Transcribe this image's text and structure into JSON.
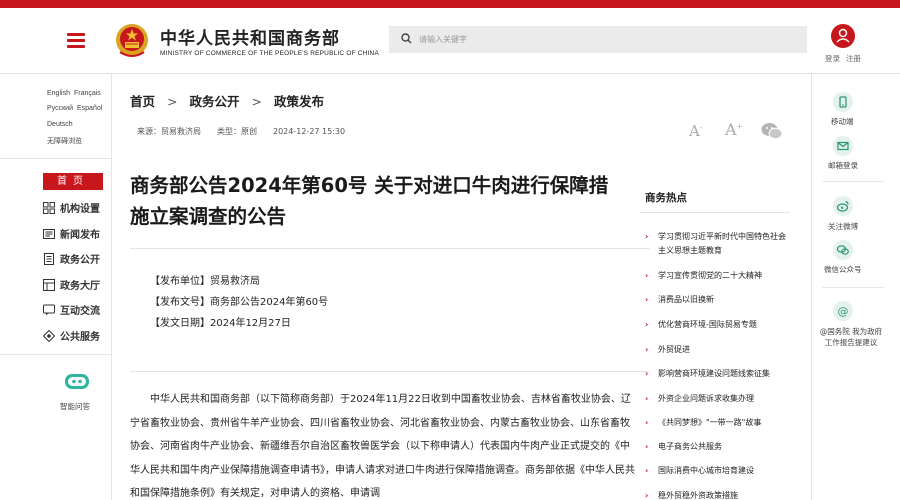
{
  "header": {
    "logo_cn": "中华人民共和国商务部",
    "logo_en": "MINISTRY OF COMMERCE OF THE PEOPLE'S REPUBLIC OF CHINA",
    "search_placeholder": "请输入关键字",
    "login": "登录",
    "register": "注册"
  },
  "left": {
    "languages": [
      [
        "English",
        "Français"
      ],
      [
        "Русский",
        "Español"
      ],
      [
        "Deutsch"
      ]
    ],
    "accessibility": "无障碍浏览",
    "nav_home": "首页",
    "nav": [
      "机构设置",
      "新闻发布",
      "政务公开",
      "政务大厅",
      "互动交流",
      "公共服务"
    ],
    "robot_label": "智能问答"
  },
  "breadcrumb": [
    "首页",
    "政务公开",
    "政策发布"
  ],
  "meta": {
    "source": "来源：贸易救济局",
    "type": "类型：原创",
    "date": "2024-12-27 15:30"
  },
  "article": {
    "title": "商务部公告2024年第60号 关于对进口牛肉进行保障措施立案调查的公告",
    "info": [
      "【发布单位】贸易救济局",
      "【发布文号】商务部公告2024年第60号",
      "【发文日期】2024年12月27日"
    ],
    "body": "中华人民共和国商务部（以下简称商务部）于2024年11月22日收到中国畜牧业协会、吉林省畜牧业协会、辽宁省畜牧业协会、贵州省牛羊产业协会、四川省畜牧业协会、河北省畜牧业协会、内蒙古畜牧业协会、山东省畜牧协会、河南省肉牛产业协会、新疆维吾尔自治区畜牧兽医学会（以下称申请人）代表国内牛肉产业正式提交的《中华人民共和国牛肉产业保障措施调查申请书》，申请人请求对进口牛肉进行保障措施调查。商务部依据《中华人民共和国保障措施条例》有关规定，对申请人的资格、申请调"
  },
  "hot": {
    "title": "商务热点",
    "items": [
      "学习贯彻习近平新时代中国特色社会主义思想主题教育",
      "学习宣传贯彻党的二十大精神",
      "消费品以旧换新",
      "优化营商环境-国际贸易专题",
      "外贸促进",
      "影响营商环境建设问题线索征集",
      "外资企业问题诉求收集办理",
      "《共同梦想》\"一带一路\"故事",
      "电子商务公共服务",
      "国际消费中心城市培育建设",
      "稳外贸稳外资政策措施"
    ]
  },
  "right": {
    "mobile": "移动端",
    "mail": "邮箱登录",
    "weibo": "关注微博",
    "wechat": "微信公众号",
    "gov_line1": "@国务院 我为政府",
    "gov_line2": "工作报告提建议"
  },
  "colors": {
    "brand_red": "#c8161d",
    "icon_green": "#2f9a72"
  }
}
